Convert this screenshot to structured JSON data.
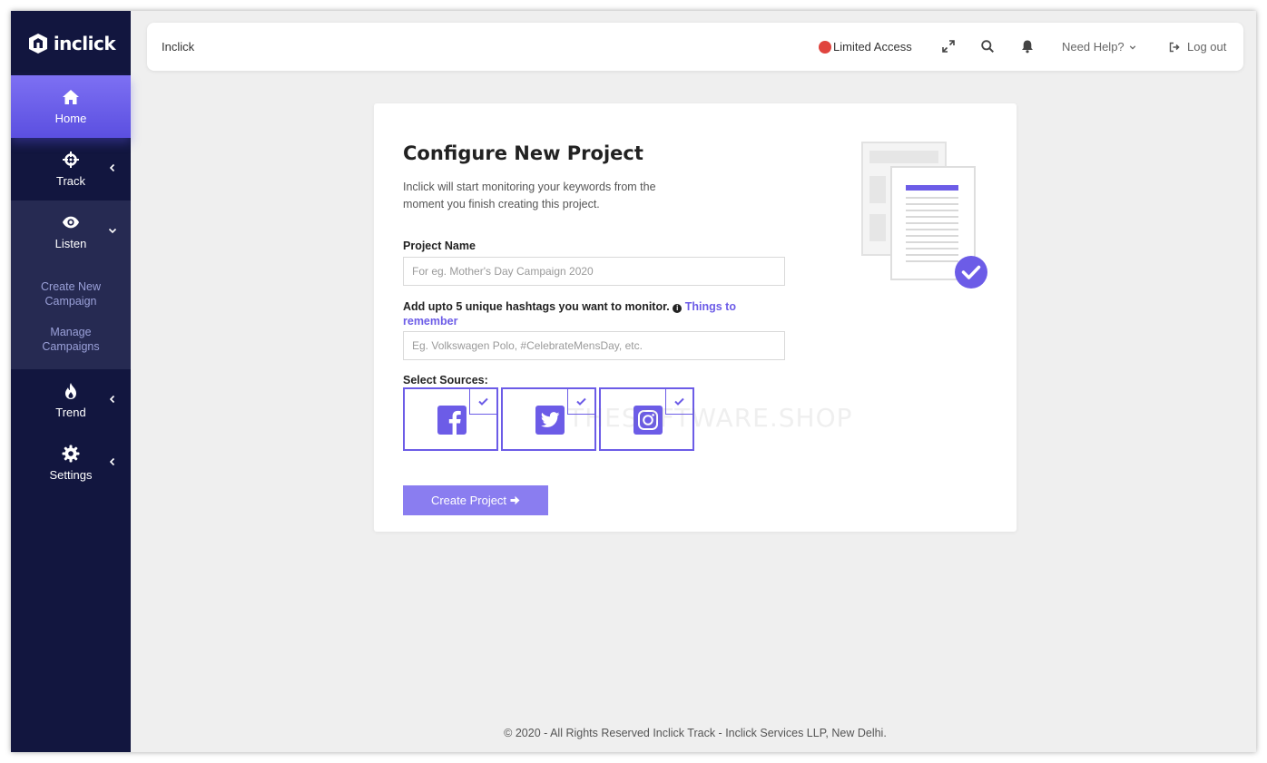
{
  "brand": {
    "name": "inclick"
  },
  "sidebar": {
    "items": [
      {
        "label": "Home",
        "icon": "home-icon"
      },
      {
        "label": "Track",
        "icon": "crosshair-icon"
      },
      {
        "label": "Listen",
        "icon": "eye-icon"
      },
      {
        "label": "Trend",
        "icon": "fire-icon"
      },
      {
        "label": "Settings",
        "icon": "gear-icon"
      }
    ],
    "listen_submenu": [
      {
        "label": "Create New Campaign"
      },
      {
        "label": "Manage Campaigns"
      }
    ]
  },
  "header": {
    "title": "Inclick",
    "access_label": "Limited Access",
    "help_label": "Need Help?",
    "logout_label": "Log out"
  },
  "form": {
    "title": "Configure New Project",
    "subtitle": "Inclick will start monitoring your keywords from the moment you finish creating this project.",
    "project_name_label": "Project Name",
    "project_name_placeholder": "For eg. Mother's Day Campaign 2020",
    "hashtags_label": "Add upto 5 unique hashtags you want to monitor.",
    "hashtags_link": "Things to remember",
    "hashtags_placeholder": "Eg. Volkswagen Polo, #CelebrateMensDay, etc.",
    "sources_label": "Select Sources:",
    "sources": [
      {
        "name": "facebook",
        "icon": "facebook-icon",
        "selected": true
      },
      {
        "name": "twitter",
        "icon": "twitter-icon",
        "selected": true
      },
      {
        "name": "instagram",
        "icon": "instagram-icon",
        "selected": true
      }
    ],
    "submit_label": "Create Project"
  },
  "watermark": "THESOFTWARE.SHOP",
  "footer": {
    "text": "© 2020 - All Rights Reserved Inclick Track - Inclick Services LLP, New Delhi."
  },
  "colors": {
    "sidebar": "#12163f",
    "accent": "#6c5ce7",
    "button": "#8a7df0",
    "status_dot": "#e0443e"
  }
}
